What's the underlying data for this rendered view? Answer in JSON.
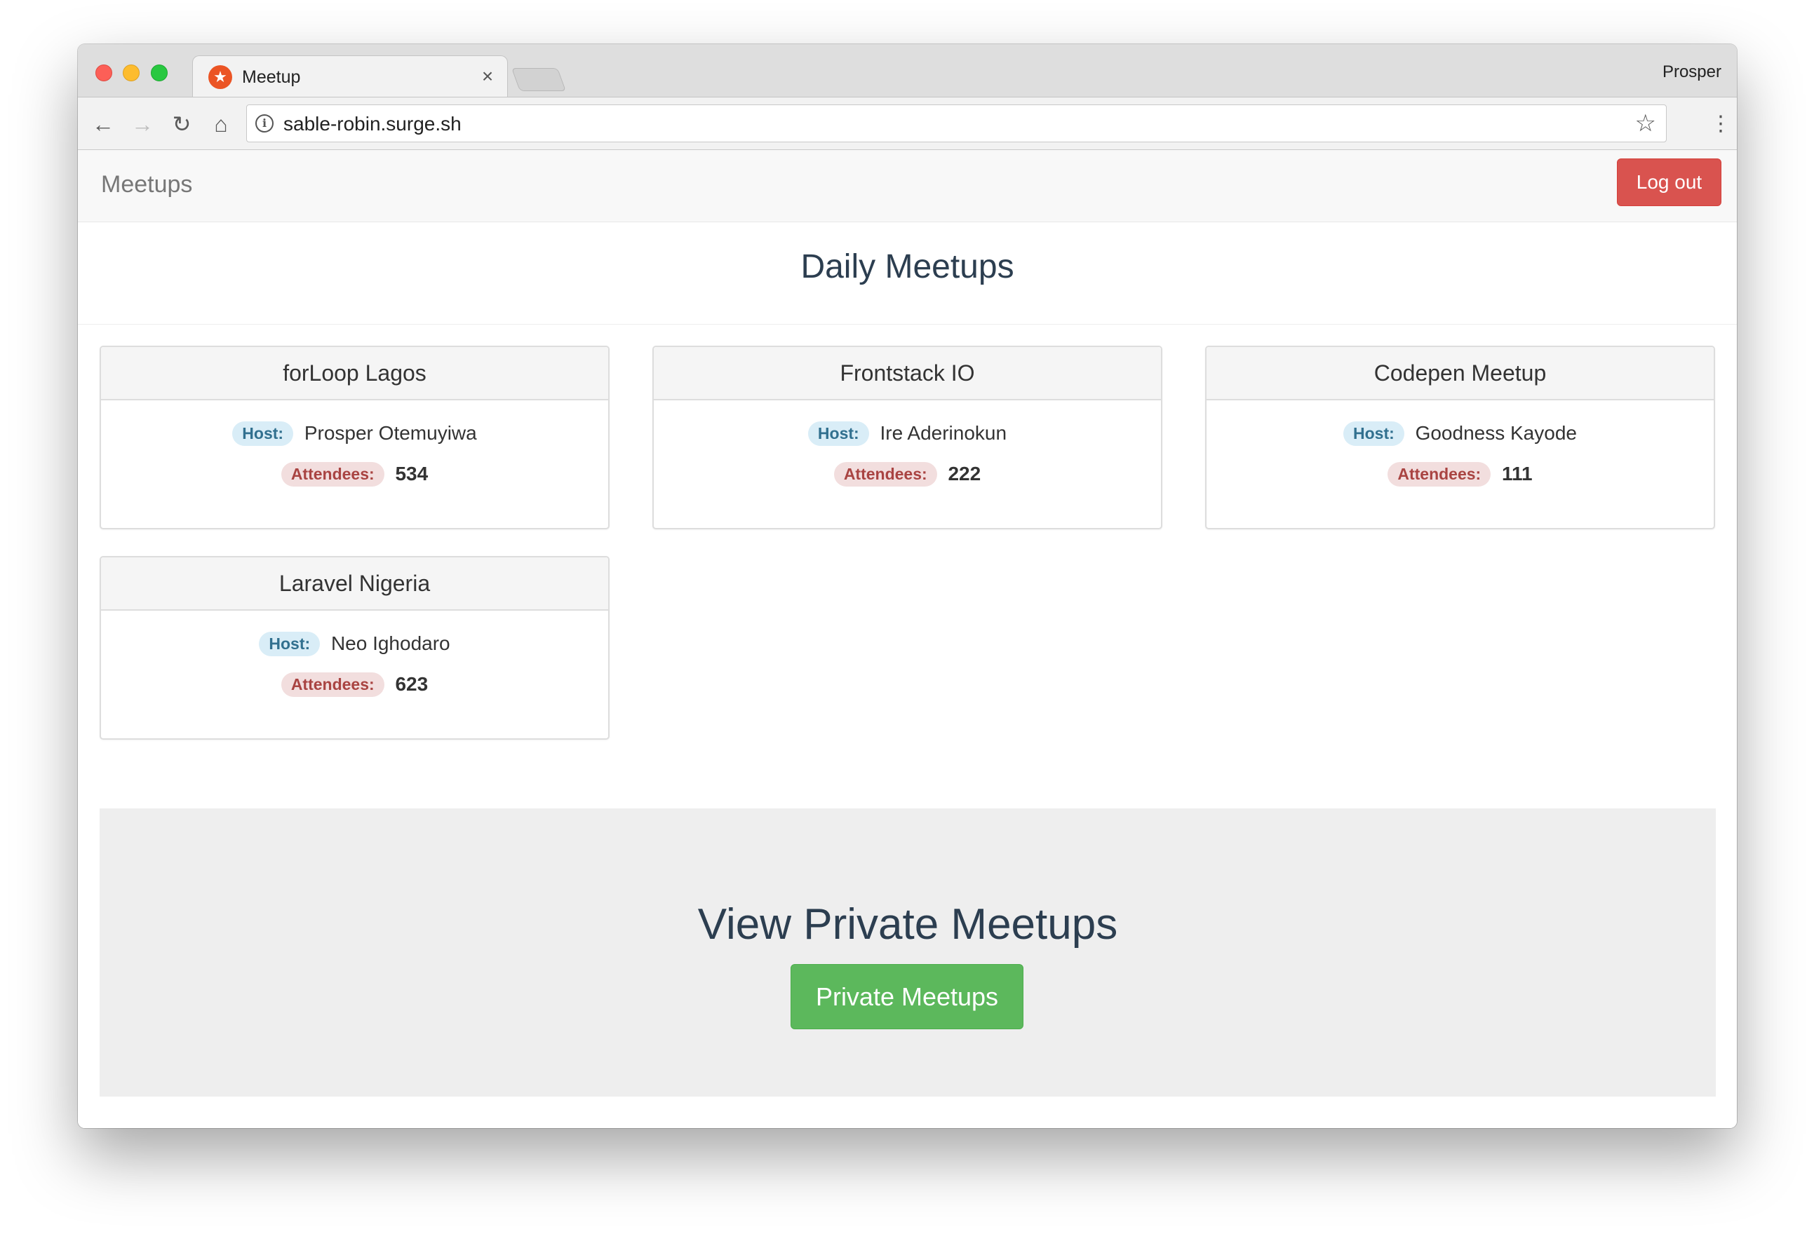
{
  "browser": {
    "tab_title": "Meetup",
    "tab_close": "×",
    "profile_name": "Prosper",
    "url": "sable-robin.surge.sh",
    "icons": {
      "favicon": "auth0-star-icon",
      "back": "arrow-left-icon",
      "forward": "arrow-right-icon",
      "reload": "reload-icon",
      "home": "home-icon",
      "info": "info-icon",
      "bookmark": "star-icon",
      "menu": "kebab-menu-icon"
    }
  },
  "navbar": {
    "brand": "Meetups",
    "logout_label": "Log out"
  },
  "header": {
    "title": "Daily Meetups"
  },
  "labels": {
    "host": "Host:",
    "attendees": "Attendees:"
  },
  "meetups": [
    {
      "name": "forLoop Lagos",
      "host": "Prosper Otemuyiwa",
      "attendees": "534"
    },
    {
      "name": "Frontstack IO",
      "host": "Ire Aderinokun",
      "attendees": "222"
    },
    {
      "name": "Codepen Meetup",
      "host": "Goodness Kayode",
      "attendees": "111"
    },
    {
      "name": "Laravel Nigeria",
      "host": "Neo Ighodaro",
      "attendees": "623"
    }
  ],
  "private": {
    "title": "View Private Meetups",
    "button_label": "Private Meetups"
  },
  "colors": {
    "danger": "#d9534f",
    "success": "#5cb85c",
    "heading": "#2c3e50",
    "host_label_bg": "#d9edf7",
    "attendees_label_bg": "#f2dede"
  }
}
